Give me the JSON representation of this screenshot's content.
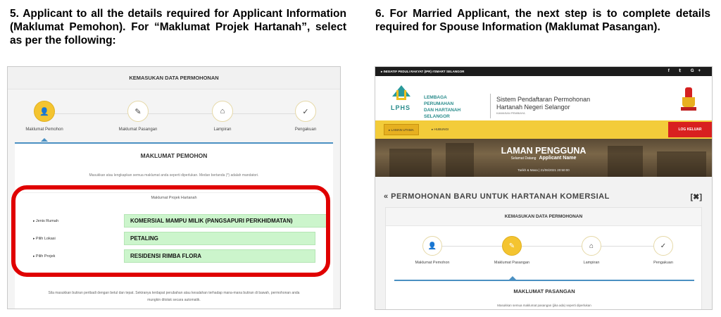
{
  "captions": {
    "left": "5. Applicant to all the details required for Applicant Information (Maklumat Pemohon). For “Maklumat Projek Hartanah”, select as per the following:",
    "right": "6. For Married Applicant, the next step is to complete details required for Spouse Information (Maklumat Pasangan)."
  },
  "left_panel": {
    "header": "KEMASUKAN DATA PERMOHONAN",
    "steps": [
      {
        "label": "Maklumat Pemohon",
        "icon": "user-icon",
        "glyph": "👤",
        "active": true
      },
      {
        "label": "Maklumat Pasangan",
        "icon": "pencil-icon",
        "glyph": "✎",
        "active": false
      },
      {
        "label": "Lampiran",
        "icon": "home-icon",
        "glyph": "⌂",
        "active": false
      },
      {
        "label": "Pengakuan",
        "icon": "check-icon",
        "glyph": "✓",
        "active": false
      }
    ],
    "section_title": "MAKLUMAT PEMOHON",
    "intro": "Masukkan atau lengkapkan semua maklumat anda seperti diperlukan. Medan bertanda (*) adalah mandatori.",
    "subsection": "Maklumat Projek Hartanah",
    "fields": [
      {
        "label": "Jenis Rumah",
        "value": "KOMERSIAL MAMPU MILIK (PANGSAPURI PERKHIDMATAN)"
      },
      {
        "label": "Pilih Lokasi",
        "value": "PETALING"
      },
      {
        "label": "Pilih Projek",
        "value": "RESIDENSI RIMBA FLORA"
      }
    ],
    "help_glyph": "?",
    "footer": "Sila masukkan butiran peribadi dengan betul dan tepat. Sekiranya terdapat perubahan atau kesalahan terhadap mana-mana butiran di bawah, permohonan anda mungkin ditolak secara automatik."
  },
  "right_panel": {
    "topbar": "▸ INISIATIF PEDULI RAKYAT (IPR) #SMART SELANGOR",
    "social": "f 𝕥 G+",
    "org": [
      "LEMBAGA",
      "PERUMAHAN",
      "DAN HARTANAH",
      "SELANGOR"
    ],
    "logo_text": "LPHS",
    "system_name_1": "Sistem Pendaftaran Permohonan",
    "system_name_2": "Hartanah Negeri Selangor",
    "system_sub": "KAWASAN PEMBIAYA",
    "nav_home": "▸ LAMAN UTAMA",
    "nav_link": "▸ HUBUNGI",
    "logout": "LOG KELUAR",
    "banner_title": "LAMAN PENGGUNA",
    "greeting": "Selamat Datang",
    "user_name": "Applicant Name",
    "date_line": "Tarikh & Masa | 21/06/2021 20:50:00",
    "page_heading": "« PERMOHONAN BARU UNTUK HARTANAH KOMERSIAL",
    "close": "[✖]",
    "card_header": "KEMASUKAN DATA PERMOHONAN",
    "steps": [
      {
        "label": "Maklumat Pemohon",
        "icon": "user-icon",
        "glyph": "👤",
        "active": false
      },
      {
        "label": "Maklumat Pasangan",
        "icon": "pencil-icon",
        "glyph": "✎",
        "active": true
      },
      {
        "label": "Lampiran",
        "icon": "home-icon",
        "glyph": "⌂",
        "active": false
      },
      {
        "label": "Pengakuan",
        "icon": "check-icon",
        "glyph": "✓",
        "active": false
      }
    ],
    "section_title": "MAKLUMAT PASANGAN",
    "intro": "Masukkan semua maklumat pasangan (jika ada) seperti diperlukan"
  },
  "colors": {
    "highlight_red": "#e00000",
    "field_green": "#ccf5cc",
    "step_active": "#f4c430",
    "nav_yellow": "#f3cc3a",
    "logout_red": "#d82020",
    "brand_teal": "#2a8c8c"
  }
}
